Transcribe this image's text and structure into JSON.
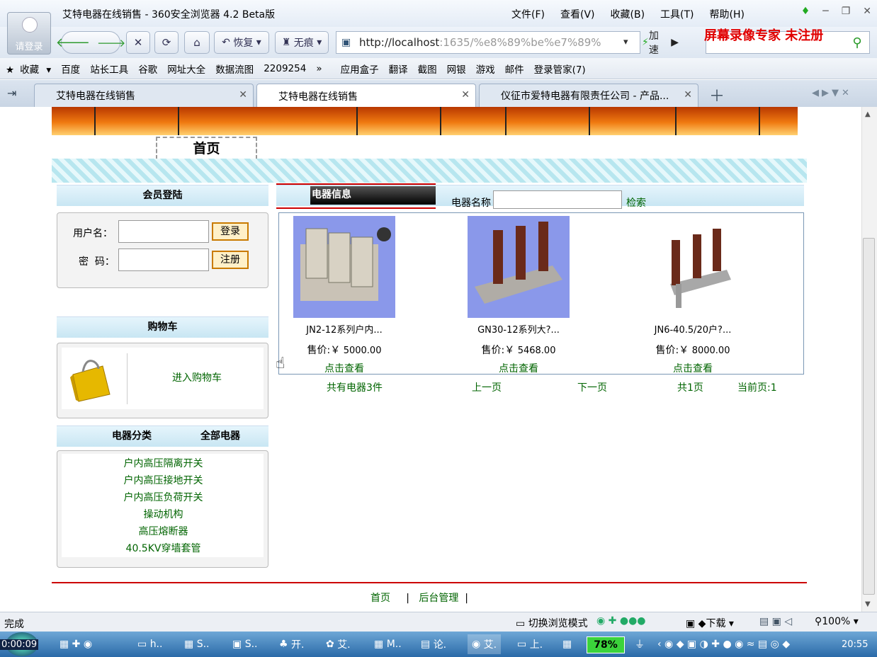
{
  "browser": {
    "window_title": "艾特电器在线销售 - 360安全浏览器 4.2 Beta版",
    "login_avatar_label": "请登录",
    "menu": [
      "文件(F)",
      "查看(V)",
      "收藏(B)",
      "工具(T)",
      "帮助(H)"
    ],
    "restore_label": "恢复",
    "trace_label": "无痕",
    "url_host": "http://localhost",
    "url_rest": ":1635/%e8%89%be%e7%89%",
    "speed_label": "加速",
    "watermark": "屏幕录像专家  未注册",
    "favorites": [
      "收藏",
      "百度",
      "站长工具",
      "谷歌",
      "网址大全",
      "数据流图",
      "2209254",
      "»",
      "应用盒子",
      "翻译",
      "截图",
      "网银",
      "游戏",
      "邮件",
      "登录管家(7)"
    ],
    "tabs": [
      {
        "title": "艾特电器在线销售"
      },
      {
        "title": "艾特电器在线销售"
      },
      {
        "title": "仪征市爱特电器有限责任公司 - 产品..."
      }
    ],
    "status_text": "完成",
    "status_right": [
      "切换浏览模式",
      "下载",
      "100%"
    ]
  },
  "site": {
    "home_tab": "首页",
    "login": {
      "header": "会员登陆",
      "username_label": "用户名：",
      "password_label": "密  码：",
      "login_button": "登录",
      "register_button": "注册"
    },
    "cart": {
      "header": "购物车",
      "link": "进入购物车"
    },
    "categories": {
      "header": "电器分类",
      "all_link": "全部电器",
      "items": [
        "户内高压隔离开关",
        "户内高压接地开关",
        "户内高压负荷开关",
        "操动机构",
        "高压熔断器",
        "40.5KV穿墙套管"
      ]
    },
    "products_section": {
      "header": "电器信息",
      "search_label": "电器名称",
      "search_value": "",
      "search_button": "检索"
    },
    "products": [
      {
        "name": "JN2-12系列户内...",
        "price_label": "售价:￥",
        "price": "5000.00",
        "view": "点击查看"
      },
      {
        "name": "GN30-12系列大?...",
        "price_label": "售价:￥",
        "price": "5468.00",
        "view": "点击查看"
      },
      {
        "name": "JN6-40.5/20户?...",
        "price_label": "售价:￥",
        "price": "8000.00",
        "view": "点击查看"
      }
    ],
    "pager": {
      "total": "共有电器3件",
      "prev": "上一页",
      "next": "下一页",
      "pages": "共1页",
      "current": "当前页:1"
    },
    "footer": {
      "home": "首页",
      "sep": "|",
      "admin": "后台管理"
    }
  },
  "taskbar": {
    "recording_time": "0:00:09",
    "items": [
      "h..",
      "S..",
      "S..",
      "开.",
      "艾.",
      "M..",
      "论.",
      "艾.",
      "上."
    ],
    "battery": "78%",
    "clock": "20:55"
  }
}
